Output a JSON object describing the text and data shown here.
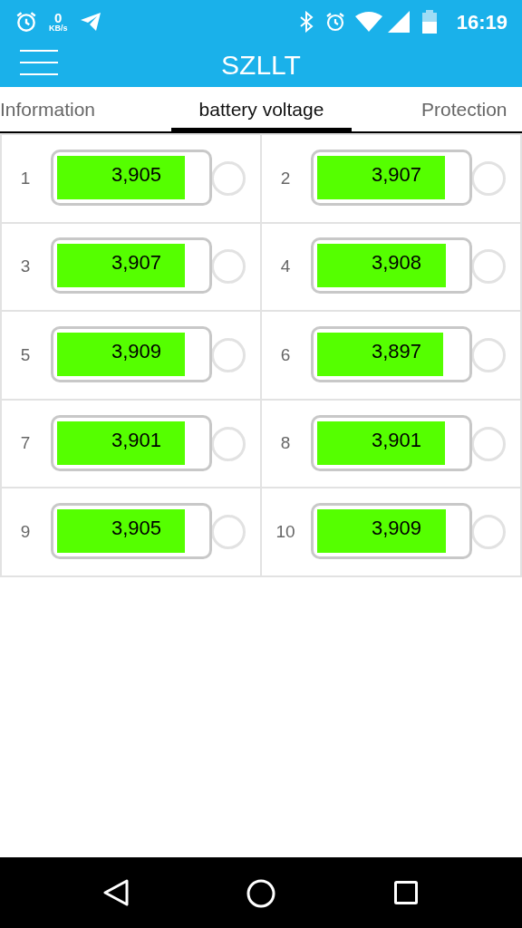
{
  "status_bar": {
    "speed_value": "0",
    "speed_unit": "KB/s",
    "time": "16:19"
  },
  "app_bar": {
    "title": "SZLLT"
  },
  "tabs": [
    {
      "label": "Information",
      "selected": false
    },
    {
      "label": "battery voltage",
      "selected": true
    },
    {
      "label": "Protection",
      "selected": false
    }
  ],
  "cells": [
    {
      "index": "1",
      "voltage": "3,905",
      "level": 0.86
    },
    {
      "index": "2",
      "voltage": "3,907",
      "level": 0.86
    },
    {
      "index": "3",
      "voltage": "3,907",
      "level": 0.86
    },
    {
      "index": "4",
      "voltage": "3,908",
      "level": 0.865
    },
    {
      "index": "5",
      "voltage": "3,909",
      "level": 0.86
    },
    {
      "index": "6",
      "voltage": "3,897",
      "level": 0.85
    },
    {
      "index": "7",
      "voltage": "3,901",
      "level": 0.86
    },
    {
      "index": "8",
      "voltage": "3,901",
      "level": 0.86
    },
    {
      "index": "9",
      "voltage": "3,905",
      "level": 0.86
    },
    {
      "index": "10",
      "voltage": "3,909",
      "level": 0.865
    }
  ]
}
